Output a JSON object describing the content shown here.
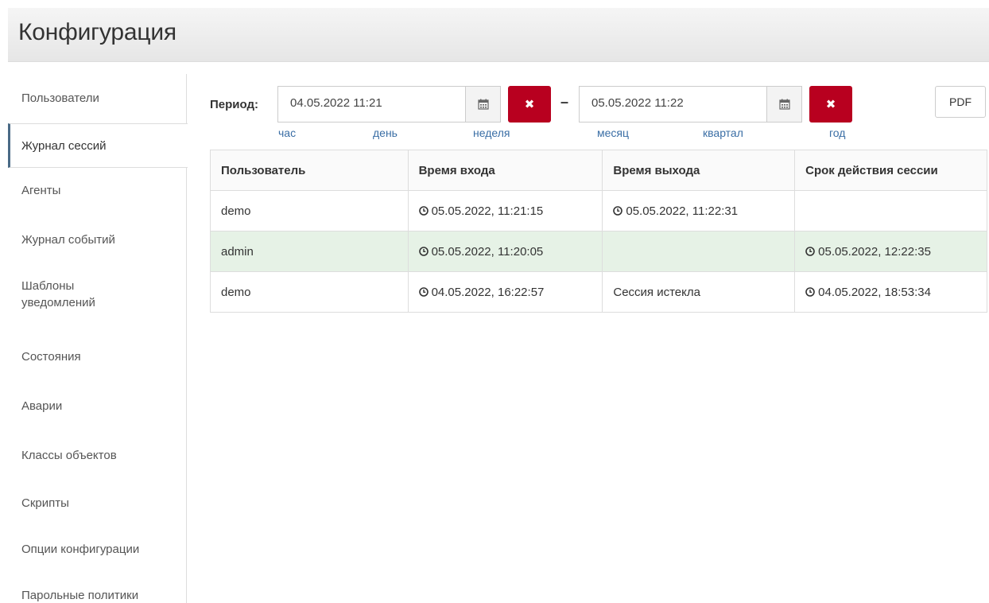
{
  "header": {
    "title": "Конфигурация"
  },
  "sidebar": {
    "items": [
      {
        "label": "Пользователи"
      },
      {
        "label": "Журнал сессий"
      },
      {
        "label": "Агенты"
      },
      {
        "label": "Журнал событий"
      },
      {
        "label": "Шаблоны уведомлений"
      },
      {
        "label": "Состояния"
      },
      {
        "label": "Аварии"
      },
      {
        "label": "Классы объектов"
      },
      {
        "label": "Скрипты"
      },
      {
        "label": "Опции конфигурации"
      },
      {
        "label": "Парольные политики"
      }
    ],
    "active_item": "Журнал сессий"
  },
  "toolbar": {
    "period_label": "Период:",
    "from_value": "04.05.2022 11:21",
    "to_value": "05.05.2022 11:22",
    "separator": "–",
    "clear_glyph": "✖",
    "pdf_label": "PDF",
    "quick_links": [
      "час",
      "день",
      "неделя",
      "месяц",
      "квартал",
      "год"
    ]
  },
  "table": {
    "columns": [
      "Пользователь",
      "Время входа",
      "Время выхода",
      "Срок действия сессии"
    ],
    "rows": [
      [
        "demo",
        "05.05.2022, 11:21:15",
        "05.05.2022, 11:22:31",
        ""
      ],
      [
        "admin",
        "05.05.2022, 11:20:05",
        "",
        "05.05.2022, 12:22:35"
      ],
      [
        "demo",
        "04.05.2022, 16:22:57",
        "Сессия истекла",
        "04.05.2022, 18:53:34"
      ]
    ]
  },
  "icons": {
    "calendar": "calendar-icon",
    "clear": "close-icon",
    "clock": "clock-icon"
  },
  "colors": {
    "danger": "#b8001f",
    "link": "#3a6ea5",
    "row_highlight": "#e6f2e6",
    "active_border": "#4a6a86"
  }
}
